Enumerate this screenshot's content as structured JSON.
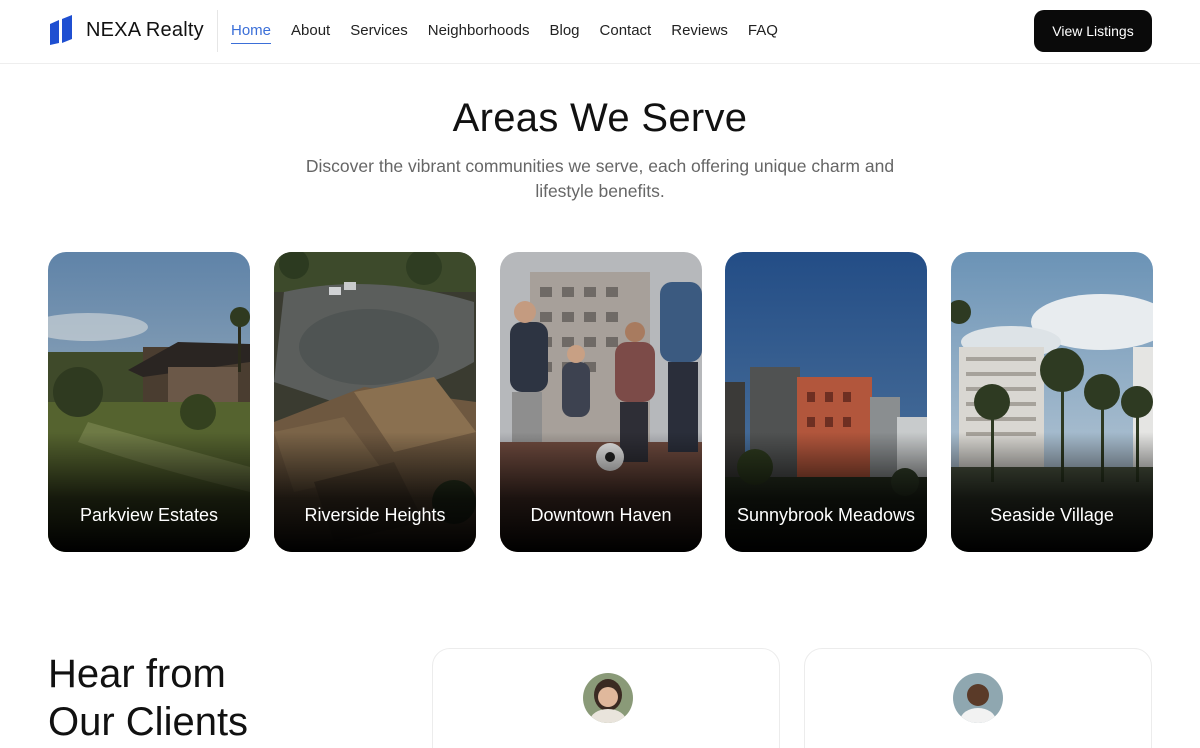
{
  "brand": {
    "name": "NEXA Realty",
    "logo_icon": "bars-logo-icon",
    "accent": "#1f4fd1"
  },
  "nav": {
    "items": [
      {
        "label": "Home",
        "active": true
      },
      {
        "label": "About"
      },
      {
        "label": "Services"
      },
      {
        "label": "Neighborhoods"
      },
      {
        "label": "Blog"
      },
      {
        "label": "Contact"
      },
      {
        "label": "Reviews"
      },
      {
        "label": "FAQ"
      }
    ],
    "active_color": "#3b6fd8",
    "cta_label": "View Listings"
  },
  "areas": {
    "title": "Areas We Serve",
    "subtitle": "Discover the vibrant communities we serve, each offering unique charm and lifestyle benefits.",
    "cards": [
      {
        "label": "Parkview Estates"
      },
      {
        "label": "Riverside Heights"
      },
      {
        "label": "Downtown Haven"
      },
      {
        "label": "Sunnybrook Meadows"
      },
      {
        "label": "Seaside Village"
      }
    ]
  },
  "testimonials": {
    "title_line1": "Hear from",
    "title_line2": "Our Clients"
  }
}
